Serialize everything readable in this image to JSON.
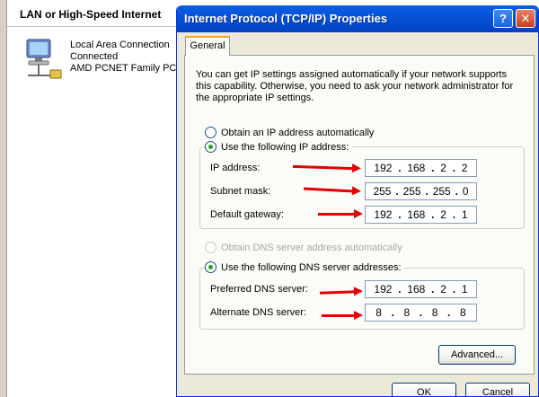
{
  "background": {
    "header": "LAN or High-Speed Internet",
    "connection": {
      "name": "Local Area Connection",
      "status": "Connected",
      "adapter": "AMD PCNET Family PCI E",
      "icon": "network-computer-icon"
    }
  },
  "dialog": {
    "title": "Internet Protocol (TCP/IP) Properties",
    "help_label": "?",
    "close_label": "✕",
    "tab_general": "General",
    "intro": "You can get IP settings assigned automatically if your network supports this capability. Otherwise, you need to ask your network administrator for the appropriate IP settings.",
    "ip": {
      "auto_label": "Obtain an IP address automatically",
      "manual_label": "Use the following IP address:",
      "fields": [
        {
          "label": "IP address:",
          "octets": [
            "192",
            "168",
            "2",
            "2"
          ]
        },
        {
          "label": "Subnet mask:",
          "octets": [
            "255",
            "255",
            "255",
            "0"
          ]
        },
        {
          "label": "Default gateway:",
          "octets": [
            "192",
            "168",
            "2",
            "1"
          ]
        }
      ]
    },
    "dns": {
      "auto_label": "Obtain DNS server address automatically",
      "manual_label": "Use the following DNS server addresses:",
      "fields": [
        {
          "label": "Preferred DNS server:",
          "octets": [
            "192",
            "168",
            "2",
            "1"
          ]
        },
        {
          "label": "Alternate DNS server:",
          "octets": [
            "8",
            "8",
            "8",
            "8"
          ]
        }
      ]
    },
    "advanced_label": "Advanced...",
    "ok_label": "OK",
    "cancel_label": "Cancel"
  },
  "colors": {
    "titlebar": "#0653d6",
    "arrow": "#e30000",
    "dialog_bg": "#ece9d8"
  }
}
